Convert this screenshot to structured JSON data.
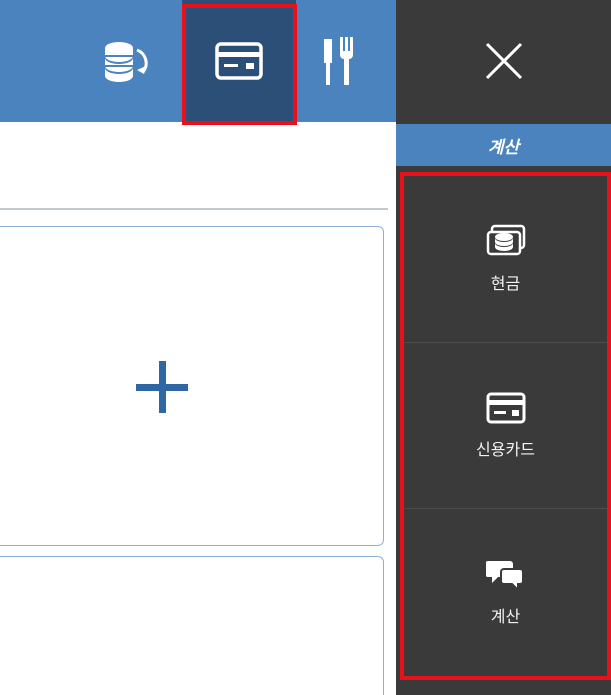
{
  "topbar": {
    "icons": [
      "coins-exchange-icon",
      "credit-card-icon",
      "utensils-icon"
    ]
  },
  "main": {
    "add_icon": "plus-icon"
  },
  "right_panel": {
    "close_icon": "close-icon",
    "header": "계산",
    "items": [
      {
        "label": "현금",
        "icon": "cash-icon"
      },
      {
        "label": "신용카드",
        "icon": "credit-card-icon"
      },
      {
        "label": "계산",
        "icon": "chat-bubbles-icon"
      }
    ]
  },
  "colors": {
    "topbar": "#4a83bd",
    "selected_tab": "#2c4f78",
    "panel_bg": "#3a3a3a",
    "highlight": "#e8101a",
    "accent": "#2f67a5"
  }
}
